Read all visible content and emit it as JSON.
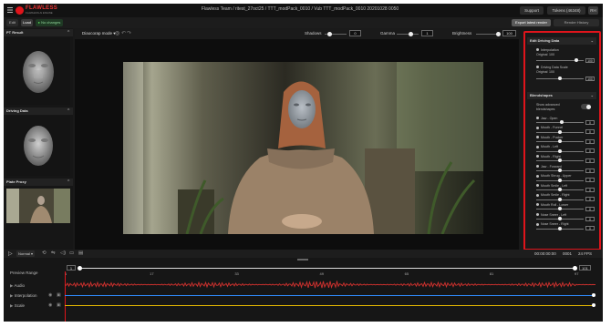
{
  "topbar": {
    "logo_text": "FLAWLESS",
    "logo_sub": "FLAWLESS AI ENGINE",
    "breadcrumb": "Flawless Team / ritest_27oct25 / TTT_modPack_0010 / Vub TTT_modPack_0010 20201028 0050",
    "support": "Support",
    "tokens": "Tokens (46348)",
    "avatar": "RH"
  },
  "subbar": {
    "edit": "Edit",
    "load": "Load",
    "no_changes": "No changes",
    "export_label": "Export latest render",
    "render_history": "Render History"
  },
  "left_panel": {
    "pt_result": "PT Result",
    "driving_data": "Driving Data",
    "plate_proxy": "Plate Proxy"
  },
  "viewer": {
    "mode": "Diaocorap mode",
    "shadows_label": "Shadows",
    "shadows_value": "0",
    "gamma_label": "Gamma",
    "gamma_value": "1",
    "brightness_label": "Brightness",
    "brightness_value": "100"
  },
  "right_panel": {
    "edit_driving_data": "Edit Driving Data",
    "interpolation": "Interpolation",
    "interpolation_original": "Original",
    "interpolation_original_val": "100",
    "interpolation_value": "100",
    "driving_scale": "Driving Data Scale",
    "driving_scale_original": "Original",
    "driving_scale_original_val": "100",
    "driving_scale_value": "100",
    "blendshapes": "Blendshapes",
    "show_advanced": "Show advanced",
    "show_advanced_2": "blendshapes",
    "items": [
      {
        "label": "Jaw - Open",
        "value": "0",
        "level": 0.55
      },
      {
        "label": "Mouth - Funnel",
        "value": "0",
        "level": 0.5
      },
      {
        "label": "Mouth - Pucker",
        "value": "0",
        "level": 0.5
      },
      {
        "label": "Mouth - Left",
        "value": "0",
        "level": 0.5
      },
      {
        "label": "Mouth - Right",
        "value": "0",
        "level": 0.5
      },
      {
        "label": "Jaw - Forward",
        "value": "0",
        "level": 0.5
      },
      {
        "label": "Mouth Shrug - Upper",
        "value": "0",
        "level": 0.5
      },
      {
        "label": "Mouth Smile - Left",
        "value": "0",
        "level": 0.5
      },
      {
        "label": "Mouth Smile - Right",
        "value": "0",
        "level": 0.5
      },
      {
        "label": "Mouth Roll - Lower",
        "value": "0",
        "level": 0.5
      },
      {
        "label": "Nose Sneer - Left",
        "value": "0",
        "level": 0.5
      },
      {
        "label": "Nose Sneer - Right",
        "value": "0",
        "level": 0.5
      }
    ]
  },
  "transport": {
    "speed": "Normal",
    "timecode": "00:00:00:00",
    "frame": "0001",
    "fps": "24 FPS"
  },
  "timeline": {
    "preview_range": "Preview Range",
    "range_start": "1",
    "range_end": "101",
    "ticks": [
      "1",
      "17",
      "33",
      "49",
      "65",
      "81",
      "97"
    ],
    "tracks": [
      "Audio",
      "Interpolation",
      "Scale"
    ],
    "track_colors": {
      "interpolation": "#2f8cff",
      "scale": "#e6b800",
      "audio": "#c8302d"
    }
  }
}
